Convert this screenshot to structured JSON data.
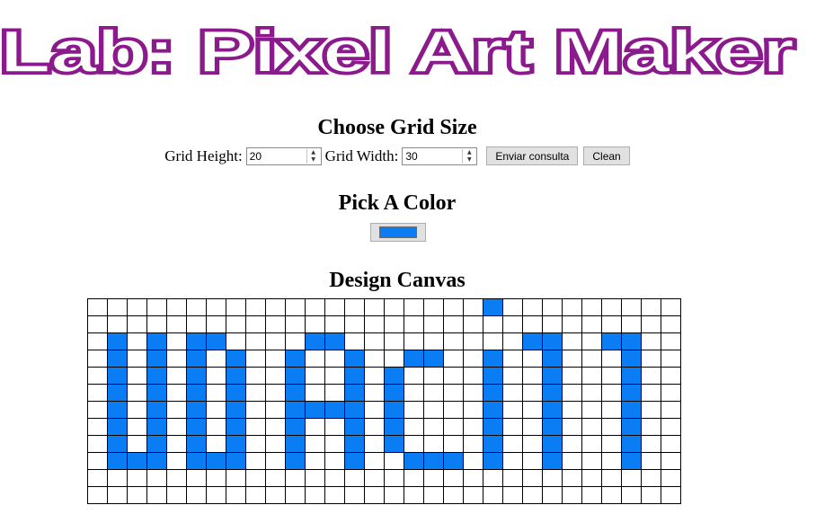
{
  "page": {
    "title": "Lab: Pixel Art Maker",
    "title_color": "#8b1a8c"
  },
  "grid_section": {
    "heading": "Choose Grid Size",
    "height_label": "Grid Height:",
    "height_value": "20",
    "width_label": "Grid Width:",
    "width_value": "30",
    "submit_label": "Enviar consulta",
    "clean_label": "Clean"
  },
  "color_section": {
    "heading": "Pick A Color",
    "selected_color": "#0a7cf4"
  },
  "canvas_section": {
    "heading": "Design Canvas",
    "paint_color": "#0a7cf4",
    "visible_rows": 12,
    "visible_cols": 30,
    "painted_cells": [
      [
        0,
        20
      ],
      [
        2,
        1
      ],
      [
        2,
        3
      ],
      [
        2,
        5
      ],
      [
        2,
        6
      ],
      [
        2,
        11
      ],
      [
        2,
        12
      ],
      [
        2,
        22
      ],
      [
        2,
        23
      ],
      [
        2,
        26
      ],
      [
        2,
        27
      ],
      [
        3,
        1
      ],
      [
        3,
        3
      ],
      [
        3,
        5
      ],
      [
        3,
        7
      ],
      [
        3,
        10
      ],
      [
        3,
        13
      ],
      [
        3,
        16
      ],
      [
        3,
        17
      ],
      [
        3,
        20
      ],
      [
        3,
        23
      ],
      [
        3,
        27
      ],
      [
        4,
        1
      ],
      [
        4,
        3
      ],
      [
        4,
        5
      ],
      [
        4,
        7
      ],
      [
        4,
        10
      ],
      [
        4,
        13
      ],
      [
        4,
        15
      ],
      [
        4,
        20
      ],
      [
        4,
        23
      ],
      [
        4,
        27
      ],
      [
        5,
        1
      ],
      [
        5,
        3
      ],
      [
        5,
        5
      ],
      [
        5,
        7
      ],
      [
        5,
        10
      ],
      [
        5,
        13
      ],
      [
        5,
        15
      ],
      [
        5,
        20
      ],
      [
        5,
        23
      ],
      [
        5,
        27
      ],
      [
        6,
        1
      ],
      [
        6,
        3
      ],
      [
        6,
        5
      ],
      [
        6,
        7
      ],
      [
        6,
        10
      ],
      [
        6,
        11
      ],
      [
        6,
        12
      ],
      [
        6,
        13
      ],
      [
        6,
        15
      ],
      [
        6,
        20
      ],
      [
        6,
        23
      ],
      [
        6,
        27
      ],
      [
        7,
        1
      ],
      [
        7,
        3
      ],
      [
        7,
        5
      ],
      [
        7,
        7
      ],
      [
        7,
        10
      ],
      [
        7,
        13
      ],
      [
        7,
        15
      ],
      [
        7,
        20
      ],
      [
        7,
        23
      ],
      [
        7,
        27
      ],
      [
        8,
        1
      ],
      [
        8,
        3
      ],
      [
        8,
        5
      ],
      [
        8,
        7
      ],
      [
        8,
        10
      ],
      [
        8,
        13
      ],
      [
        8,
        15
      ],
      [
        8,
        20
      ],
      [
        8,
        23
      ],
      [
        8,
        27
      ],
      [
        9,
        1
      ],
      [
        9,
        2
      ],
      [
        9,
        3
      ],
      [
        9,
        5
      ],
      [
        9,
        6
      ],
      [
        9,
        7
      ],
      [
        9,
        10
      ],
      [
        9,
        13
      ],
      [
        9,
        16
      ],
      [
        9,
        17
      ],
      [
        9,
        18
      ],
      [
        9,
        20
      ],
      [
        9,
        23
      ],
      [
        9,
        27
      ]
    ]
  }
}
